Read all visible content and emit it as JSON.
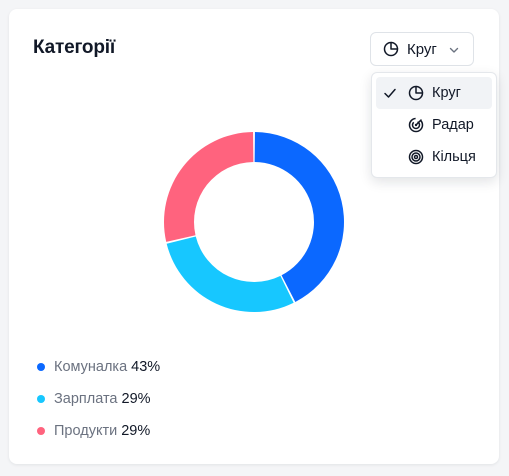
{
  "card": {
    "title": "Категорії"
  },
  "chart_type_select": {
    "selected_label": "Круг",
    "icon": "pie-chart-icon",
    "options": [
      {
        "label": "Круг",
        "icon": "pie-chart-icon",
        "selected": true
      },
      {
        "label": "Радар",
        "icon": "radar-icon",
        "selected": false
      },
      {
        "label": "Кільця",
        "icon": "rings-icon",
        "selected": false
      }
    ]
  },
  "chart_data": {
    "type": "pie",
    "variant": "donut",
    "categories": [
      "Комуналка",
      "Зарплата",
      "Продукти"
    ],
    "values": [
      43,
      29,
      29
    ],
    "value_labels": [
      "43%",
      "29%",
      "29%"
    ],
    "colors": [
      "#0b68ff",
      "#17c7ff",
      "#ff637e"
    ],
    "legend_position": "bottom-left"
  }
}
